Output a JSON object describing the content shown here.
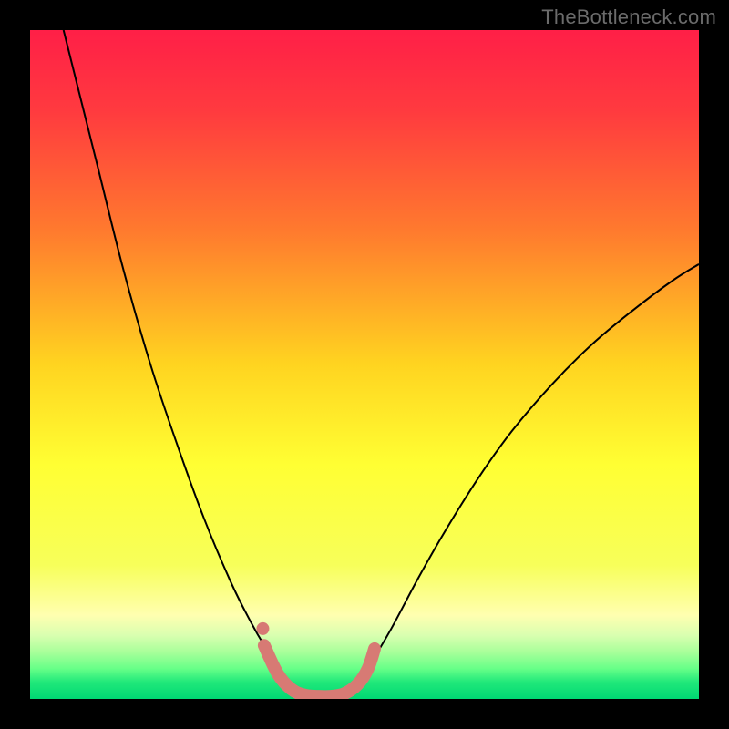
{
  "watermark": "TheBottleneck.com",
  "chart_data": {
    "type": "line",
    "title": "",
    "xlabel": "",
    "ylabel": "",
    "xlim": [
      0,
      100
    ],
    "ylim": [
      0,
      100
    ],
    "background_gradient": {
      "stops": [
        {
          "offset": 0,
          "color": "#ff1f47"
        },
        {
          "offset": 0.12,
          "color": "#ff3a3f"
        },
        {
          "offset": 0.3,
          "color": "#ff7a2e"
        },
        {
          "offset": 0.5,
          "color": "#ffd420"
        },
        {
          "offset": 0.65,
          "color": "#ffff33"
        },
        {
          "offset": 0.8,
          "color": "#f7ff5a"
        },
        {
          "offset": 0.875,
          "color": "#ffffb0"
        },
        {
          "offset": 0.905,
          "color": "#d9ffb0"
        },
        {
          "offset": 0.93,
          "color": "#a8ff9a"
        },
        {
          "offset": 0.955,
          "color": "#66ff88"
        },
        {
          "offset": 0.975,
          "color": "#20e87a"
        },
        {
          "offset": 1.0,
          "color": "#00d873"
        }
      ]
    },
    "series": [
      {
        "name": "bottleneck-curve",
        "color": "#000000",
        "width": 2,
        "points": [
          {
            "x": 5.0,
            "y": 100.0
          },
          {
            "x": 7.0,
            "y": 92.0
          },
          {
            "x": 10.0,
            "y": 80.0
          },
          {
            "x": 14.0,
            "y": 64.0
          },
          {
            "x": 18.0,
            "y": 50.0
          },
          {
            "x": 22.0,
            "y": 38.0
          },
          {
            "x": 26.0,
            "y": 27.0
          },
          {
            "x": 30.0,
            "y": 17.5
          },
          {
            "x": 33.0,
            "y": 11.5
          },
          {
            "x": 35.0,
            "y": 8.0
          },
          {
            "x": 37.0,
            "y": 5.0
          },
          {
            "x": 39.0,
            "y": 2.5
          },
          {
            "x": 41.0,
            "y": 1.0
          },
          {
            "x": 43.0,
            "y": 0.3
          },
          {
            "x": 45.0,
            "y": 0.3
          },
          {
            "x": 47.0,
            "y": 1.0
          },
          {
            "x": 49.0,
            "y": 2.8
          },
          {
            "x": 51.0,
            "y": 5.5
          },
          {
            "x": 54.0,
            "y": 10.5
          },
          {
            "x": 58.0,
            "y": 18.0
          },
          {
            "x": 62.0,
            "y": 25.0
          },
          {
            "x": 67.0,
            "y": 33.0
          },
          {
            "x": 72.0,
            "y": 40.0
          },
          {
            "x": 78.0,
            "y": 47.0
          },
          {
            "x": 84.0,
            "y": 53.0
          },
          {
            "x": 90.0,
            "y": 58.0
          },
          {
            "x": 96.0,
            "y": 62.5
          },
          {
            "x": 100.0,
            "y": 65.0
          }
        ]
      },
      {
        "name": "highlight-region",
        "color": "#d77a74",
        "width": 14,
        "linecap": "round",
        "points": [
          {
            "x": 35.0,
            "y": 8.0
          },
          {
            "x": 37.0,
            "y": 3.8
          },
          {
            "x": 39.0,
            "y": 1.5
          },
          {
            "x": 41.0,
            "y": 0.6
          },
          {
            "x": 43.0,
            "y": 0.4
          },
          {
            "x": 45.0,
            "y": 0.4
          },
          {
            "x": 47.0,
            "y": 0.8
          },
          {
            "x": 49.0,
            "y": 2.2
          },
          {
            "x": 50.5,
            "y": 4.5
          },
          {
            "x": 51.5,
            "y": 7.5
          }
        ]
      }
    ],
    "markers": [
      {
        "name": "highlight-dot",
        "x": 34.8,
        "y": 10.5,
        "r": 7,
        "color": "#d77a74"
      }
    ]
  }
}
